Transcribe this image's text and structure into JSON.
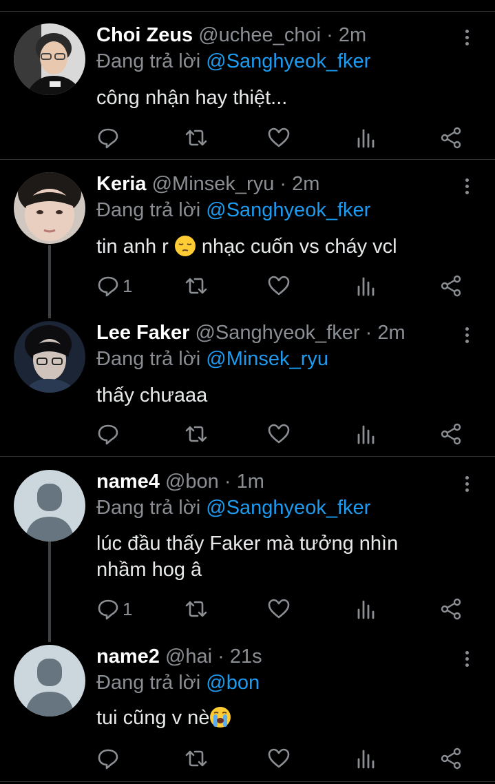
{
  "tweets": [
    {
      "name": "Choi Zeus",
      "handle": "@uchee_choi",
      "time": "2m",
      "replying_prefix": "Đang trả lời",
      "replying_to": "@Sanghyeok_fker",
      "text": "công nhận hay thiệt...",
      "reply_count": ""
    },
    {
      "name": "Keria",
      "handle": "@Minsek_ryu",
      "time": "2m",
      "replying_prefix": "Đang trả lời",
      "replying_to": "@Sanghyeok_fker",
      "text_before": "tin anh r",
      "text_emoji": "pensive-face",
      "text_after": "nhạc cuốn vs cháy vcl",
      "reply_count": "1"
    },
    {
      "name": "Lee Faker",
      "handle": "@Sanghyeok_fker",
      "time": "2m",
      "replying_prefix": "Đang trả lời",
      "replying_to": "@Minsek_ryu",
      "text": "thấy chưaaa",
      "reply_count": ""
    },
    {
      "name": "name4",
      "handle": "@bon",
      "time": "1m",
      "replying_prefix": "Đang trả lời",
      "replying_to": "@Sanghyeok_fker",
      "text": "lúc đầu thấy Faker mà tưởng nhìn nhầm hog â",
      "reply_count": "1"
    },
    {
      "name": "name2",
      "handle": "@hai",
      "time": "21s",
      "replying_prefix": "Đang trả lời",
      "replying_to": "@bon",
      "text_before": "tui cũng v nè",
      "text_emoji": "loudly-crying-face",
      "reply_count": ""
    }
  ],
  "separator": "·",
  "colors": {
    "background": "#000000",
    "accent": "#1d9bf0",
    "muted": "#8b8f94",
    "divider": "#2f3336"
  }
}
